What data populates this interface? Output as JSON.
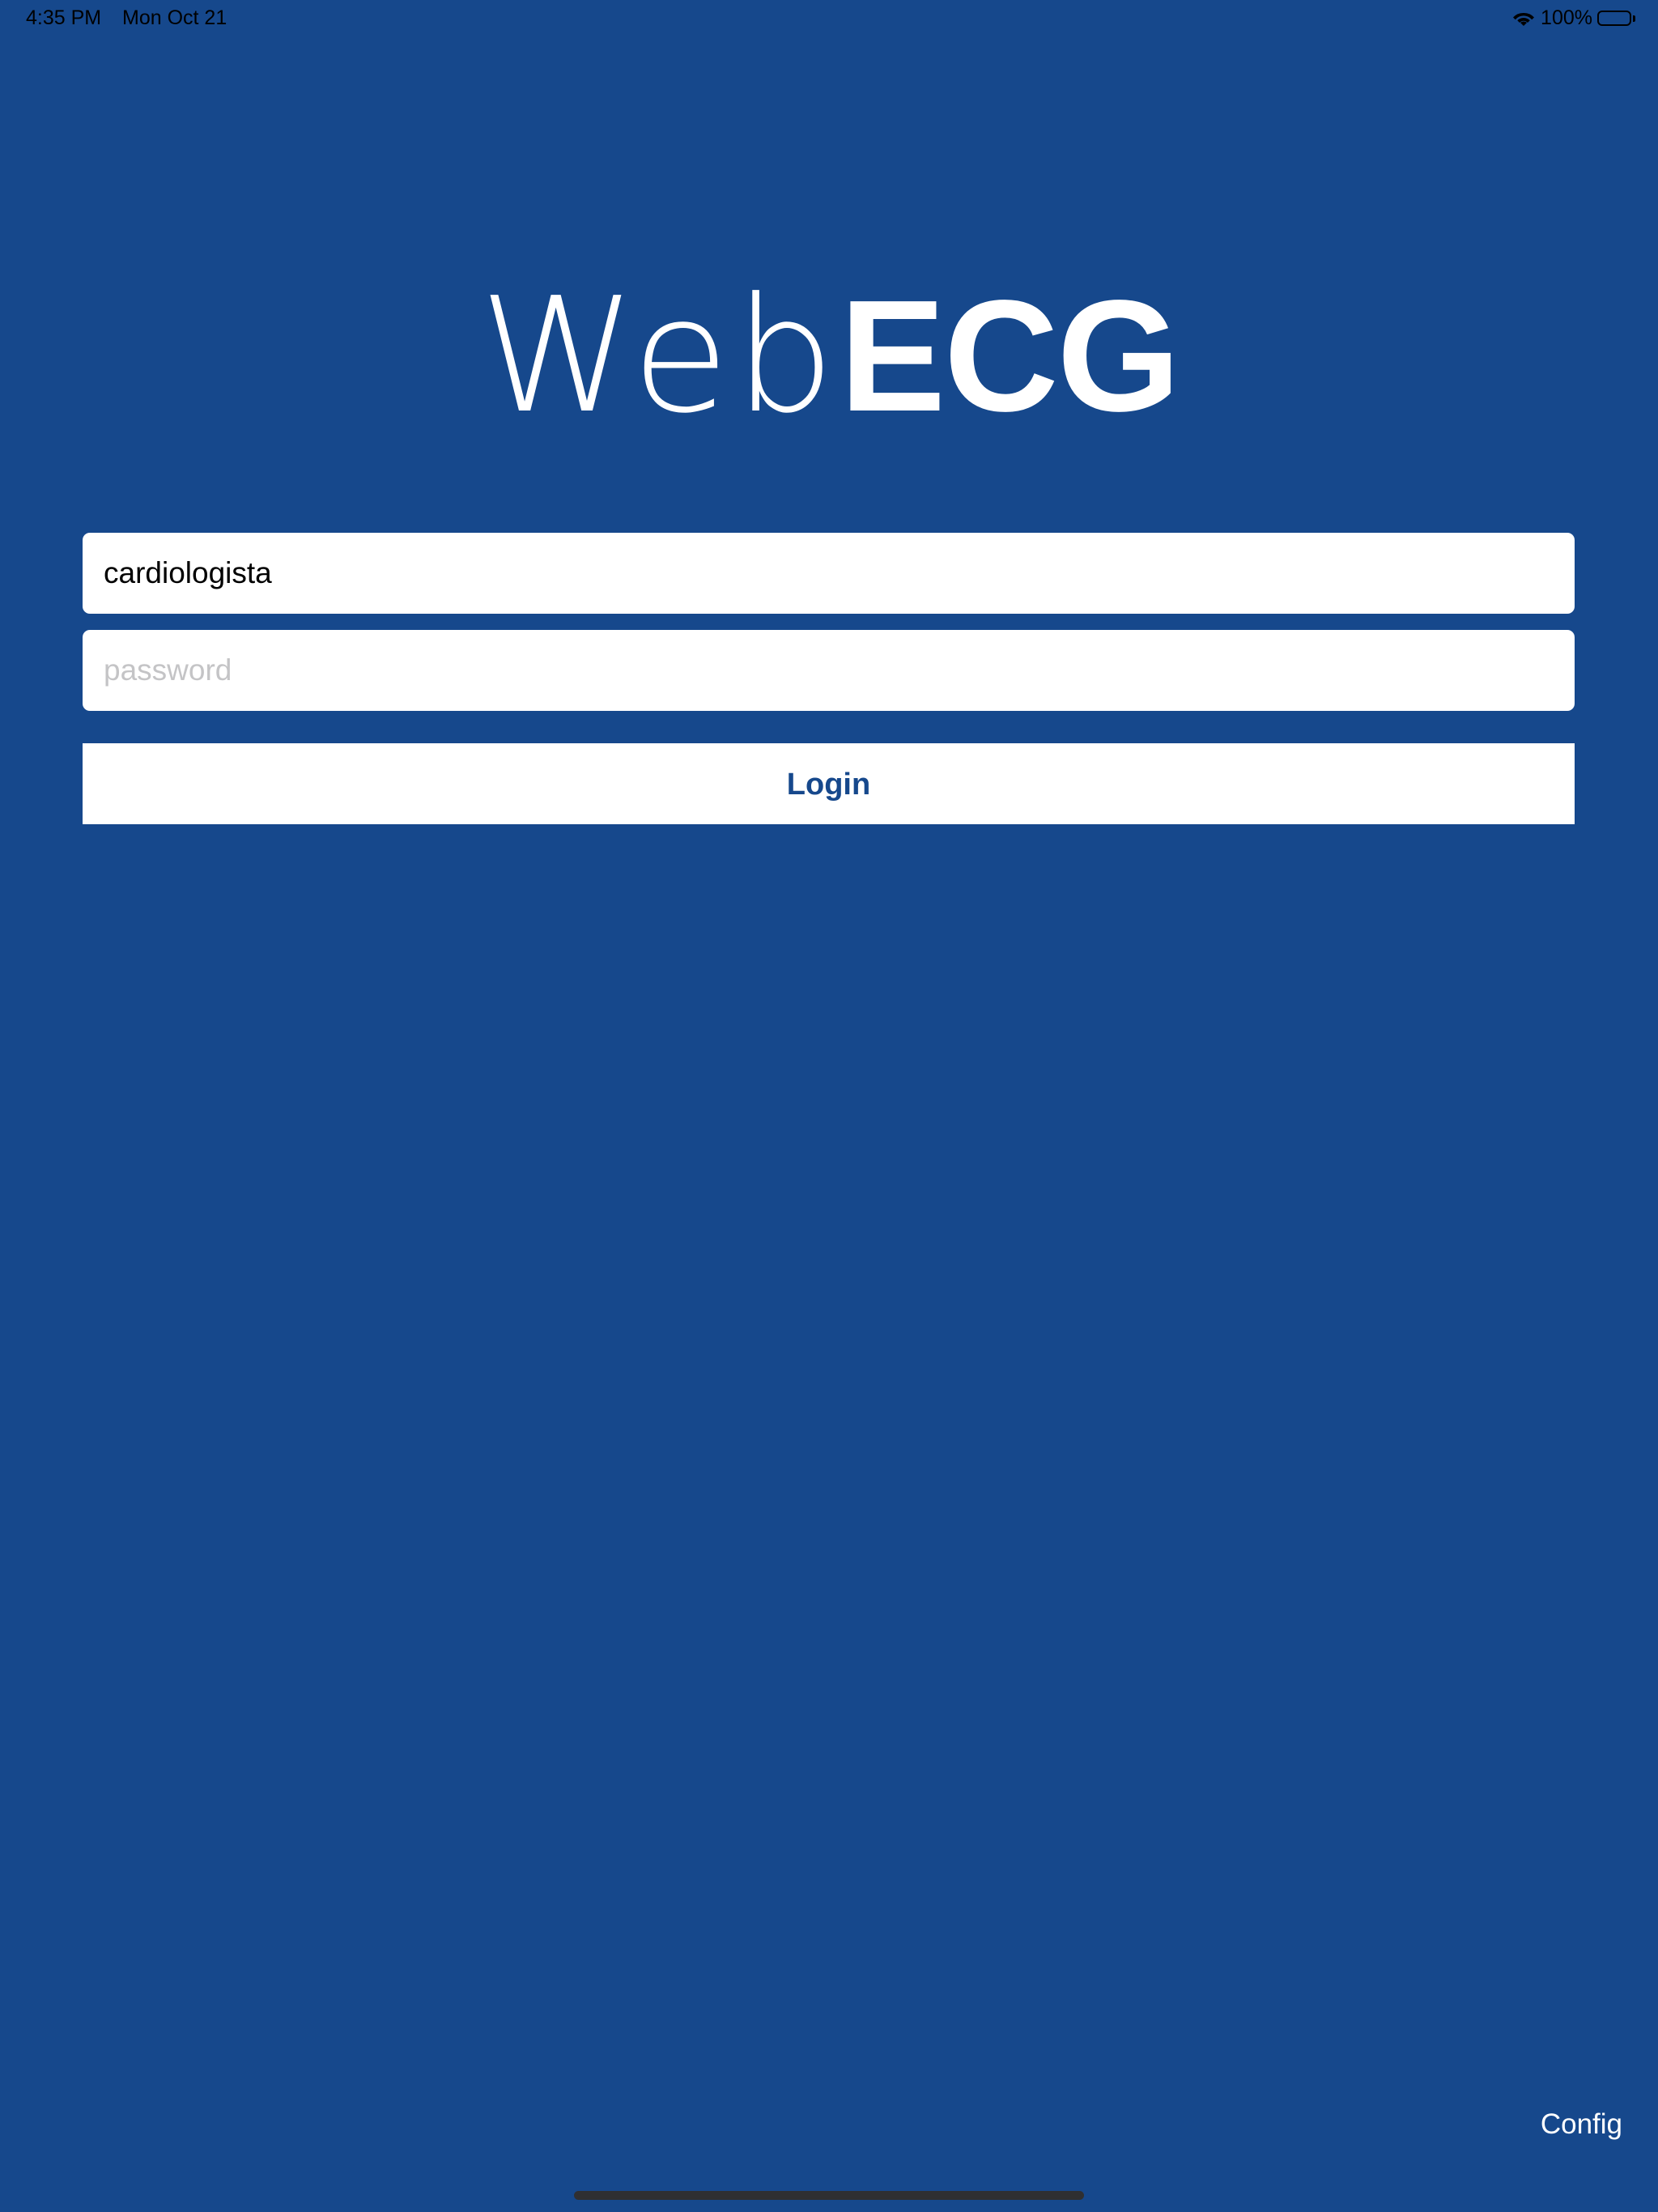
{
  "status_bar": {
    "time": "4:35 PM",
    "date": "Mon Oct 21",
    "battery_percent": "100%",
    "battery_level": 1.0
  },
  "logo": {
    "light_text": "Web",
    "bold_text": "ECG"
  },
  "login_form": {
    "username_value": "cardiologista",
    "password_placeholder": "password",
    "password_value": "",
    "login_label": "Login"
  },
  "footer": {
    "config_label": "Config"
  },
  "colors": {
    "background": "#16488c",
    "field_background": "#ffffff",
    "button_text": "#16488c"
  },
  "icons": [
    "wifi-icon",
    "battery-icon"
  ]
}
